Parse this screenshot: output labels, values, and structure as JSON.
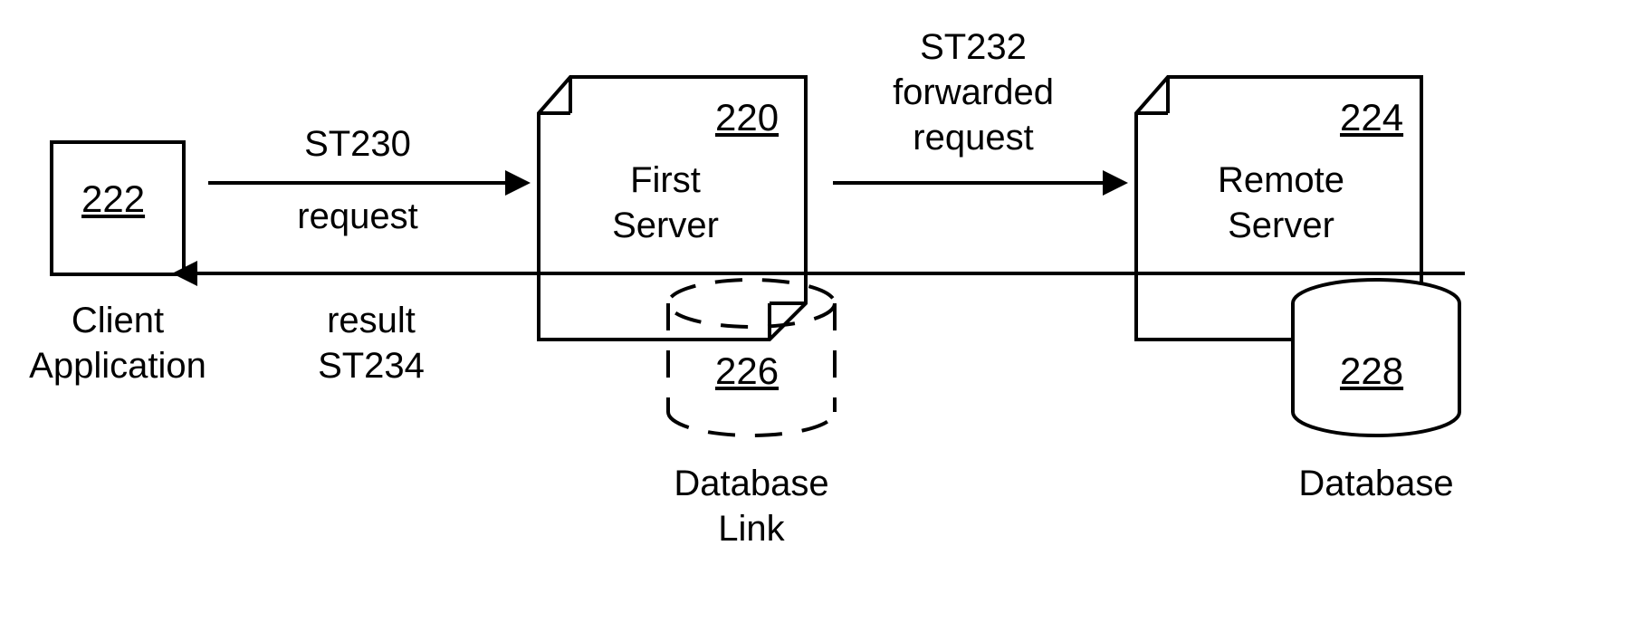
{
  "client": {
    "num": "222",
    "label1": "Client",
    "label2": "Application"
  },
  "first_server": {
    "num": "220",
    "label1": "First",
    "label2": "Server"
  },
  "remote_server": {
    "num": "224",
    "label1": "Remote",
    "label2": "Server"
  },
  "dblink": {
    "num": "226",
    "label1": "Database",
    "label2": "Link"
  },
  "database": {
    "num": "228",
    "label1": "Database"
  },
  "arrow1": {
    "line1": "ST230",
    "line2": "request"
  },
  "arrow2": {
    "line1": "ST232",
    "line2": "forwarded",
    "line3": "request"
  },
  "arrow3": {
    "line1": "result",
    "line2": "ST234"
  }
}
